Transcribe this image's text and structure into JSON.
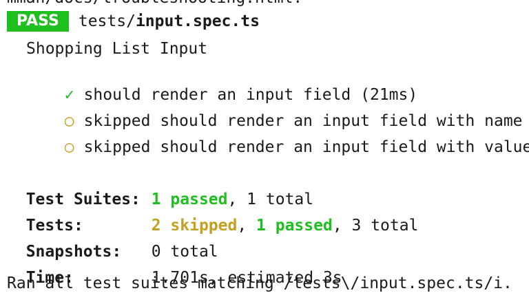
{
  "top_cut_text": "mman/docs/troubleshooting.html.",
  "badge": "PASS",
  "file": {
    "dir": "tests/",
    "name": "input.spec.ts"
  },
  "suite_name": "Shopping List Input",
  "tests": [
    {
      "status_icon": "✓",
      "text": "should render an input field (21ms)"
    },
    {
      "status_icon": "○",
      "text": "skipped should render an input field with name"
    },
    {
      "status_icon": "○",
      "text": "skipped should render an input field with value"
    }
  ],
  "summary": {
    "suites_label": "Test Suites:",
    "suites_passed": "1 passed",
    "suites_total": ", 1 total",
    "tests_label": "Tests:",
    "tests_skipped": "2 skipped",
    "tests_sep": ", ",
    "tests_passed": "1 passed",
    "tests_total": ", 3 total",
    "snapshots_label": "Snapshots:",
    "snapshots_value": "0 total",
    "time_label": "Time:",
    "time_value": "1.701s, estimated 3s",
    "ran_all": "Ran all test suites matching /tests\\/input.spec.ts/i."
  },
  "colors": {
    "pass_green": "#1fbf1f",
    "skip_yellow": "#c2a022"
  }
}
